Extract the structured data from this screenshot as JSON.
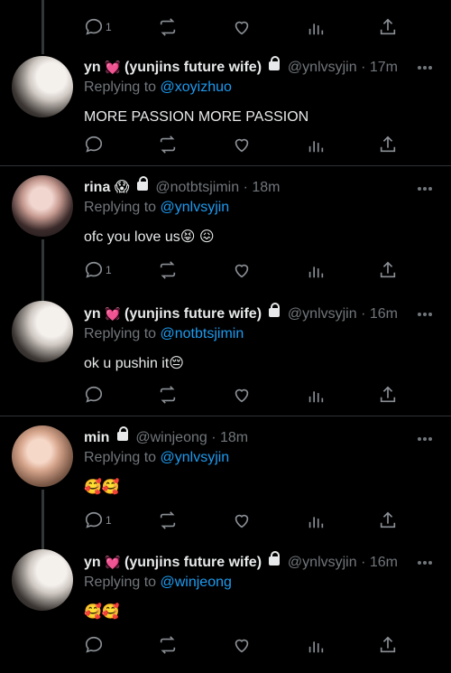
{
  "top_bar": {
    "reply_count": "1"
  },
  "tweets": [
    {
      "name": "yn",
      "emoji_after_name": "💓",
      "display_suffix": "(yunjins future wife)",
      "handle": "@ynlvsyjin",
      "time": "17m",
      "replying_to_label": "Replying to",
      "replying_to": "@xoyizhuo",
      "text": "MORE PASSION MORE PASSION",
      "reply_count": ""
    },
    {
      "name": "rina",
      "emoji_after_name": "😱",
      "display_suffix": "",
      "handle": "@notbtsjimin",
      "time": "18m",
      "replying_to_label": "Replying to",
      "replying_to": "@ynlvsyjin",
      "text": "ofc you love us😝 😖",
      "reply_count": "1"
    },
    {
      "name": "yn",
      "emoji_after_name": "💓",
      "display_suffix": "(yunjins future wife)",
      "handle": "@ynlvsyjin",
      "time": "16m",
      "replying_to_label": "Replying to",
      "replying_to": "@notbtsjimin",
      "text": "ok u pushin it😔",
      "reply_count": ""
    },
    {
      "name": "min",
      "emoji_after_name": "",
      "display_suffix": "",
      "handle": "@winjeong",
      "time": "18m",
      "replying_to_label": "Replying to",
      "replying_to": "@ynlvsyjin",
      "text": "🥰🥰",
      "reply_count": "1"
    },
    {
      "name": "yn",
      "emoji_after_name": "💓",
      "display_suffix": "(yunjins future wife)",
      "handle": "@ynlvsyjin",
      "time": "16m",
      "replying_to_label": "Replying to",
      "replying_to": "@winjeong",
      "text": "🥰🥰",
      "reply_count": ""
    }
  ],
  "separator": "·",
  "colors": {
    "background": "#000000",
    "text": "#e7e9ea",
    "secondary": "#71767b",
    "link": "#1d9bf0",
    "divider": "#2f3336",
    "thread_line": "#333639"
  },
  "icons": [
    "reply-icon",
    "retweet-icon",
    "like-icon",
    "views-icon",
    "share-icon",
    "lock-icon",
    "more-icon"
  ]
}
